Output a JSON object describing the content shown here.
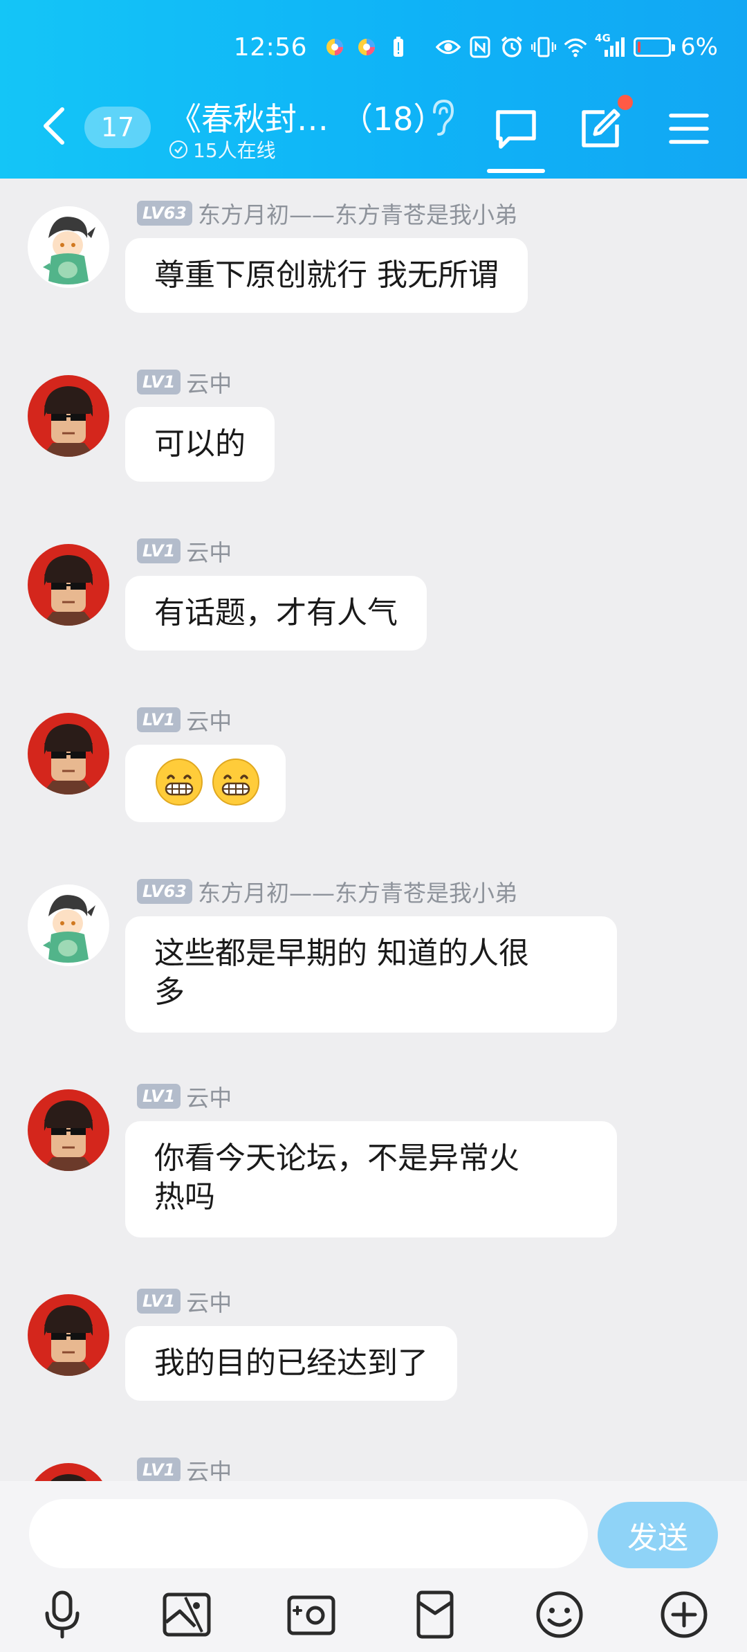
{
  "status_bar": {
    "time": "12:56",
    "battery_percent": "6%",
    "network_label": "4G",
    "battery_level": 0.06
  },
  "header": {
    "unread_count": "17",
    "title": "《春秋封…",
    "member_count": "（18）",
    "online_status": "15人在线",
    "accent_color": "#12b8f6"
  },
  "messages": [
    {
      "level": "LV63",
      "nickname": "东方月初——东方青苍是我小弟",
      "text": "尊重下原创就行  我无所谓",
      "avatar": "green-dragon-avatar"
    },
    {
      "level": "LV1",
      "nickname": "云中",
      "text": "可以的",
      "avatar": "sunglasses-man-avatar"
    },
    {
      "level": "LV1",
      "nickname": "云中",
      "text": "有话题，才有人气",
      "avatar": "sunglasses-man-avatar"
    },
    {
      "level": "LV1",
      "nickname": "云中",
      "text": "",
      "emojis": [
        "😁",
        "😁"
      ],
      "avatar": "sunglasses-man-avatar"
    },
    {
      "level": "LV63",
      "nickname": "东方月初——东方青苍是我小弟",
      "text_lines": [
        "这些都是早期的   知道的人很",
        "多"
      ],
      "avatar": "green-dragon-avatar"
    },
    {
      "level": "LV1",
      "nickname": "云中",
      "text_lines": [
        "你看今天论坛，不是异常火",
        "热吗"
      ],
      "avatar": "sunglasses-man-avatar"
    },
    {
      "level": "LV1",
      "nickname": "云中",
      "text": "我的目的已经达到了",
      "avatar": "sunglasses-man-avatar"
    },
    {
      "level": "LV1",
      "nickname": "云中",
      "text": "",
      "avatar": "sunglasses-man-avatar"
    }
  ],
  "input_bar": {
    "placeholder": "",
    "send_label": "发送",
    "tools": [
      "microphone-icon",
      "image-icon",
      "camera-icon",
      "red-packet-icon",
      "emoji-icon",
      "plus-icon"
    ]
  }
}
